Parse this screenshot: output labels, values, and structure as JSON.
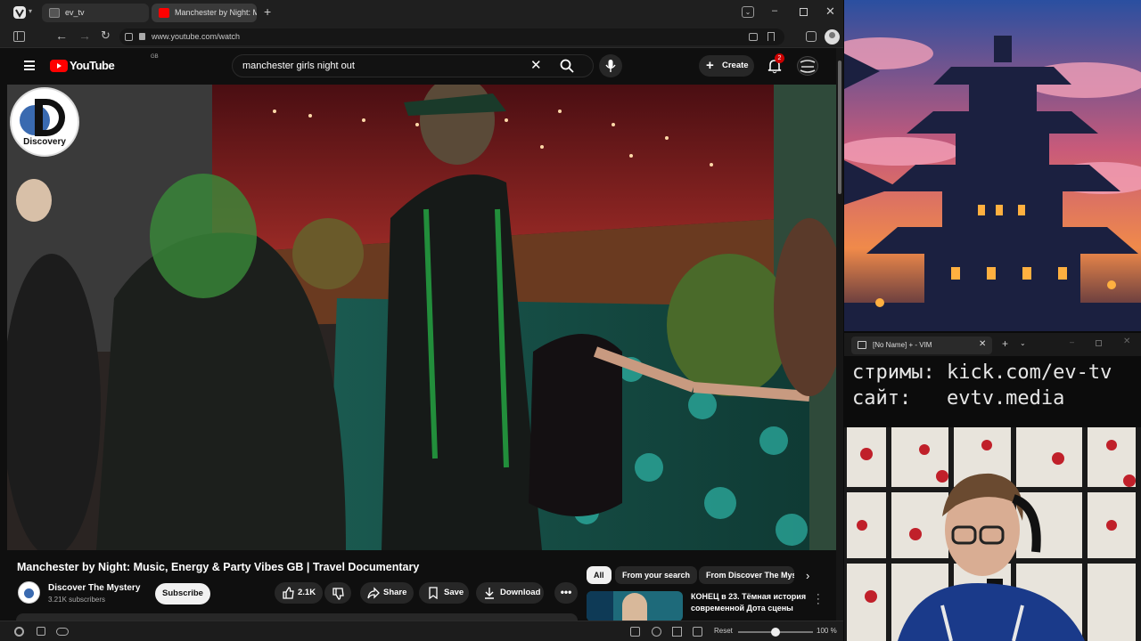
{
  "browser": {
    "tabs": [
      {
        "label": "ev_tv"
      },
      {
        "label": "Manchester by Night: Music"
      }
    ],
    "url": "www.youtube.com/watch"
  },
  "youtube": {
    "logo_text": "YouTube",
    "region": "GB",
    "search_query": "manchester girls night out",
    "create_label": "Create",
    "notifications_count": "2"
  },
  "video": {
    "channel_watermark": "Discovery",
    "title": "Manchester by Night: Music, Energy & Party Vibes GB | Travel Documentary",
    "channel_name": "Discover The Mystery",
    "subscribers": "3.21K subscribers",
    "subscribe_label": "Subscribe",
    "likes": "2.1K",
    "share_label": "Share",
    "save_label": "Save",
    "download_label": "Download"
  },
  "suggestions": {
    "chips": [
      "All",
      "From your search",
      "From Discover The Mys"
    ],
    "first_title_line1": "КОНЕЦ в 23. Тёмная история",
    "first_title_line2": "современной Дота сцены"
  },
  "status_bar": {
    "reset_label": "Reset",
    "zoom": "100 %",
    "zoom_level": 0.5
  },
  "vim": {
    "tab_title": "[No Name] + - VIM",
    "line1": "стримы: kick.com/ev-tv",
    "line2": "сайт:   evtv.media"
  },
  "colors": {
    "yt_red": "#ff0000",
    "accent_red": "#e91e3a"
  }
}
